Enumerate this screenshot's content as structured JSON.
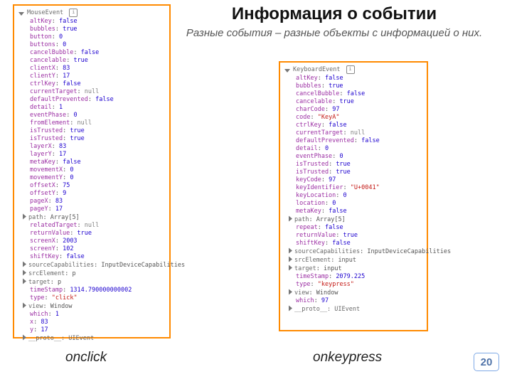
{
  "title": "Информация о событии",
  "subtitle": "Разные события – разные объекты с информацией о них.",
  "caption_left": "onclick",
  "caption_right": "onkeypress",
  "page_number": "20",
  "info_glyph": "i",
  "left": {
    "event_name": "MouseEvent",
    "proto": "__proto__: UIEvent",
    "props": [
      {
        "k": "altKey",
        "v": "false",
        "t": "bool"
      },
      {
        "k": "bubbles",
        "v": "true",
        "t": "bool"
      },
      {
        "k": "button",
        "v": "0",
        "t": "num"
      },
      {
        "k": "buttons",
        "v": "0",
        "t": "num"
      },
      {
        "k": "cancelBubble",
        "v": "false",
        "t": "bool"
      },
      {
        "k": "cancelable",
        "v": "true",
        "t": "bool"
      },
      {
        "k": "clientX",
        "v": "83",
        "t": "num"
      },
      {
        "k": "clientY",
        "v": "17",
        "t": "num"
      },
      {
        "k": "ctrlKey",
        "v": "false",
        "t": "bool"
      },
      {
        "k": "currentTarget",
        "v": "null",
        "t": "null"
      },
      {
        "k": "defaultPrevented",
        "v": "false",
        "t": "bool"
      },
      {
        "k": "detail",
        "v": "1",
        "t": "num"
      },
      {
        "k": "eventPhase",
        "v": "0",
        "t": "num"
      },
      {
        "k": "fromElement",
        "v": "null",
        "t": "null"
      },
      {
        "k": "isTrusted",
        "v": "true",
        "t": "bool"
      },
      {
        "k": "isTrusted",
        "v": "true",
        "t": "bool"
      },
      {
        "k": "layerX",
        "v": "83",
        "t": "num"
      },
      {
        "k": "layerY",
        "v": "17",
        "t": "num"
      },
      {
        "k": "metaKey",
        "v": "false",
        "t": "bool"
      },
      {
        "k": "movementX",
        "v": "0",
        "t": "num"
      },
      {
        "k": "movementY",
        "v": "0",
        "t": "num"
      },
      {
        "k": "offsetX",
        "v": "75",
        "t": "num"
      },
      {
        "k": "offsetY",
        "v": "9",
        "t": "num"
      },
      {
        "k": "pageX",
        "v": "83",
        "t": "num"
      },
      {
        "k": "pageY",
        "v": "17",
        "t": "num"
      },
      {
        "k": "path",
        "v": "Array[5]",
        "t": "obj",
        "exp": true
      },
      {
        "k": "relatedTarget",
        "v": "null",
        "t": "null"
      },
      {
        "k": "returnValue",
        "v": "true",
        "t": "bool"
      },
      {
        "k": "screenX",
        "v": "2003",
        "t": "num"
      },
      {
        "k": "screenY",
        "v": "102",
        "t": "num"
      },
      {
        "k": "shiftKey",
        "v": "false",
        "t": "bool"
      },
      {
        "k": "sourceCapabilities",
        "v": "InputDeviceCapabilities",
        "t": "obj",
        "exp": true
      },
      {
        "k": "srcElement",
        "v": "p",
        "t": "obj",
        "exp": true
      },
      {
        "k": "target",
        "v": "p",
        "t": "obj",
        "exp": true
      },
      {
        "k": "timeStamp",
        "v": "1314.790000000002",
        "t": "num"
      },
      {
        "k": "type",
        "v": "\"click\"",
        "t": "str"
      },
      {
        "k": "view",
        "v": "Window",
        "t": "obj",
        "exp": true
      },
      {
        "k": "which",
        "v": "1",
        "t": "num"
      },
      {
        "k": "x",
        "v": "83",
        "t": "num"
      },
      {
        "k": "y",
        "v": "17",
        "t": "num"
      }
    ]
  },
  "right": {
    "event_name": "KeyboardEvent",
    "proto": "__proto__: UIEvent",
    "props": [
      {
        "k": "altKey",
        "v": "false",
        "t": "bool"
      },
      {
        "k": "bubbles",
        "v": "true",
        "t": "bool"
      },
      {
        "k": "cancelBubble",
        "v": "false",
        "t": "bool"
      },
      {
        "k": "cancelable",
        "v": "true",
        "t": "bool"
      },
      {
        "k": "charCode",
        "v": "97",
        "t": "num"
      },
      {
        "k": "code",
        "v": "\"KeyA\"",
        "t": "str"
      },
      {
        "k": "ctrlKey",
        "v": "false",
        "t": "bool"
      },
      {
        "k": "currentTarget",
        "v": "null",
        "t": "null"
      },
      {
        "k": "defaultPrevented",
        "v": "false",
        "t": "bool"
      },
      {
        "k": "detail",
        "v": "0",
        "t": "num"
      },
      {
        "k": "eventPhase",
        "v": "0",
        "t": "num"
      },
      {
        "k": "isTrusted",
        "v": "true",
        "t": "bool"
      },
      {
        "k": "isTrusted",
        "v": "true",
        "t": "bool"
      },
      {
        "k": "keyCode",
        "v": "97",
        "t": "num"
      },
      {
        "k": "keyIdentifier",
        "v": "\"U+0041\"",
        "t": "str"
      },
      {
        "k": "keyLocation",
        "v": "0",
        "t": "num"
      },
      {
        "k": "location",
        "v": "0",
        "t": "num"
      },
      {
        "k": "metaKey",
        "v": "false",
        "t": "bool"
      },
      {
        "k": "path",
        "v": "Array[5]",
        "t": "obj",
        "exp": true
      },
      {
        "k": "repeat",
        "v": "false",
        "t": "bool"
      },
      {
        "k": "returnValue",
        "v": "true",
        "t": "bool"
      },
      {
        "k": "shiftKey",
        "v": "false",
        "t": "bool"
      },
      {
        "k": "sourceCapabilities",
        "v": "InputDeviceCapabilities",
        "t": "obj",
        "exp": true
      },
      {
        "k": "srcElement",
        "v": "input",
        "t": "obj",
        "exp": true
      },
      {
        "k": "target",
        "v": "input",
        "t": "obj",
        "exp": true
      },
      {
        "k": "timeStamp",
        "v": "2079.225",
        "t": "num"
      },
      {
        "k": "type",
        "v": "\"keypress\"",
        "t": "str"
      },
      {
        "k": "view",
        "v": "Window",
        "t": "obj",
        "exp": true
      },
      {
        "k": "which",
        "v": "97",
        "t": "num"
      }
    ]
  }
}
